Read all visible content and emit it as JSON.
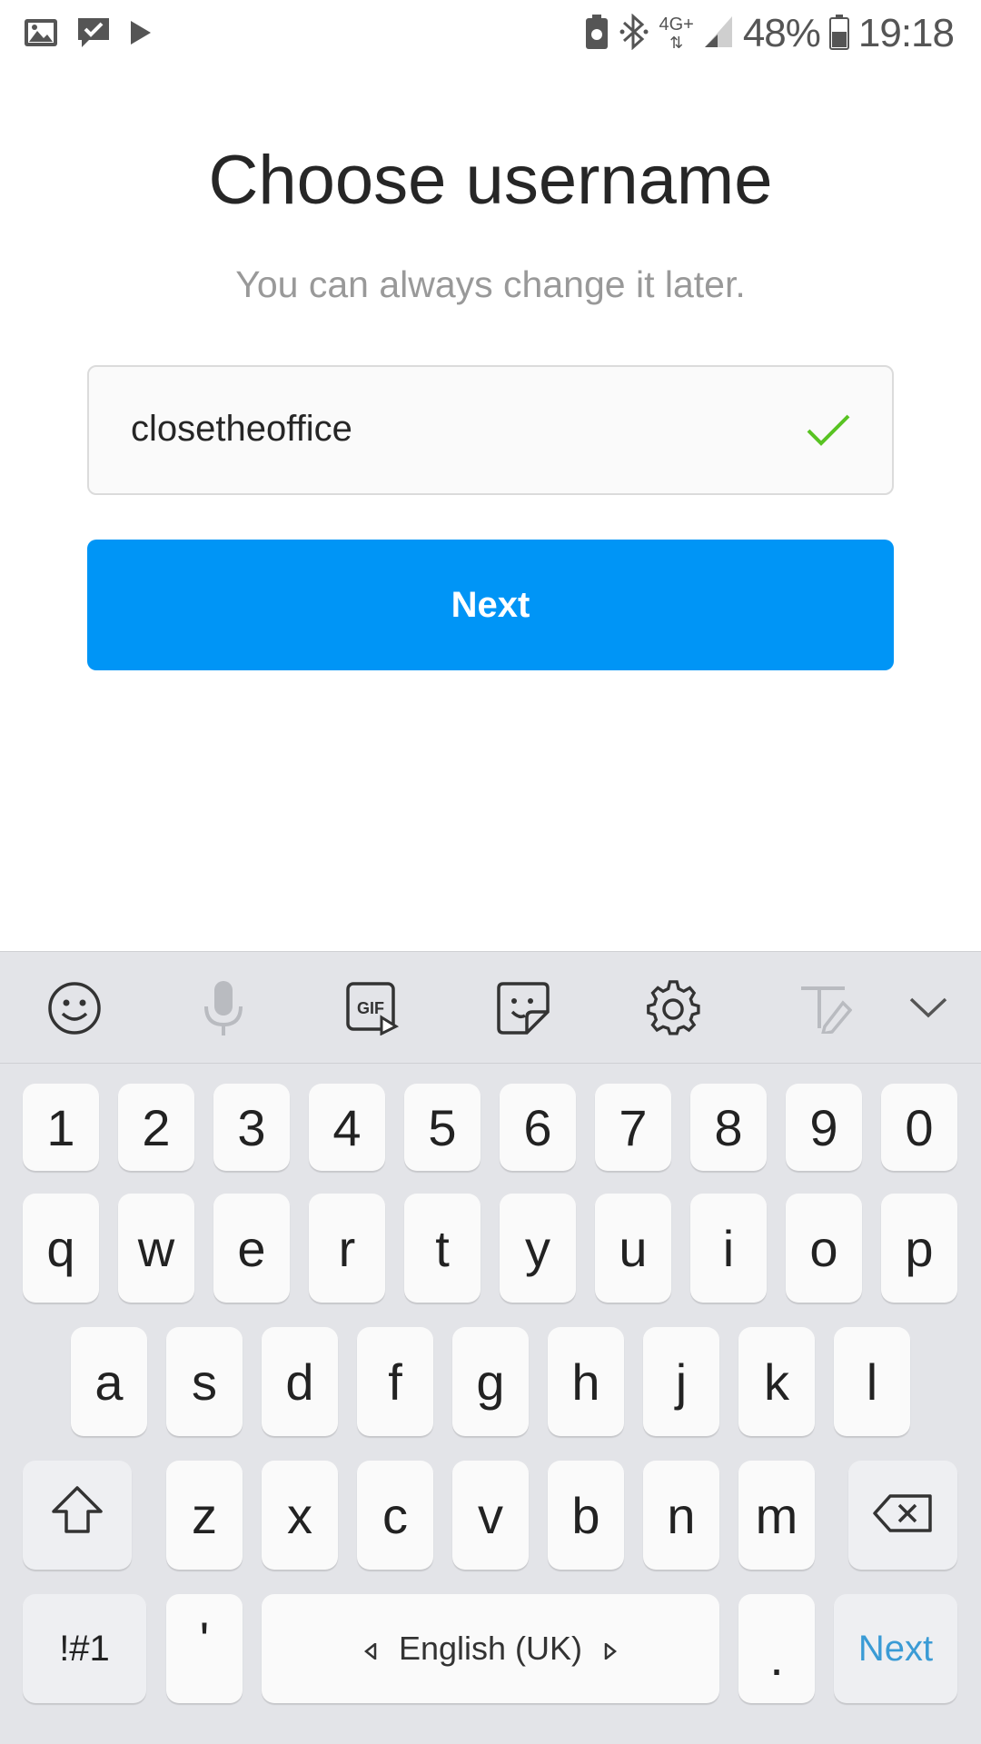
{
  "status_bar": {
    "battery_percent": "48%",
    "time": "19:18",
    "network": "4G+"
  },
  "page": {
    "title": "Choose username",
    "subtitle": "You can always change it later.",
    "username_value": "closetheoffice",
    "next_button_label": "Next"
  },
  "keyboard": {
    "toolbar_icons": [
      "emoji-icon",
      "microphone-icon",
      "gif-icon",
      "sticker-icon",
      "settings-icon",
      "handwriting-icon",
      "collapse-icon"
    ],
    "row_numbers": [
      "1",
      "2",
      "3",
      "4",
      "5",
      "6",
      "7",
      "8",
      "9",
      "0"
    ],
    "row_top": [
      "q",
      "w",
      "e",
      "r",
      "t",
      "y",
      "u",
      "i",
      "o",
      "p"
    ],
    "row_middle": [
      "a",
      "s",
      "d",
      "f",
      "g",
      "h",
      "j",
      "k",
      "l"
    ],
    "row_bottom": [
      "z",
      "x",
      "c",
      "v",
      "b",
      "n",
      "m"
    ],
    "symbols_label": "!#1",
    "apostrophe_label": "'",
    "space_label": "English (UK)",
    "period_label": ".",
    "action_label": "Next"
  },
  "colors": {
    "accent_blue": "#0095f6",
    "check_green": "#58c322",
    "keyboard_bg": "#e3e4e8"
  }
}
